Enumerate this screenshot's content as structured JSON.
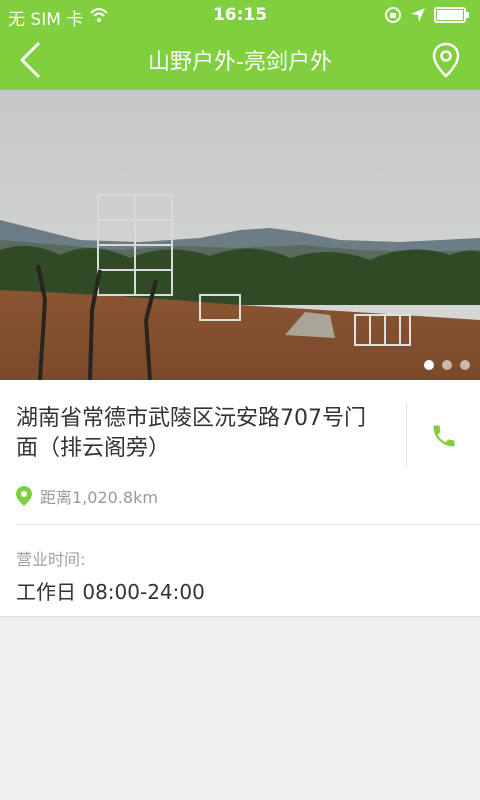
{
  "status_bar": {
    "carrier": "无 SIM 卡",
    "time": "16:15"
  },
  "nav": {
    "title": "山野户外-亮剑户外"
  },
  "gallery": {
    "count": 3,
    "active_index": 0
  },
  "store": {
    "address": "湖南省常德市武陵区沅安路707号门面（排云阁旁）",
    "distance": "距离1,020.8km",
    "hours_label": "营业时间:",
    "hours_value": "工作日 08:00-24:00"
  },
  "colors": {
    "primary": "#7fcf3f",
    "background": "#efefef"
  }
}
